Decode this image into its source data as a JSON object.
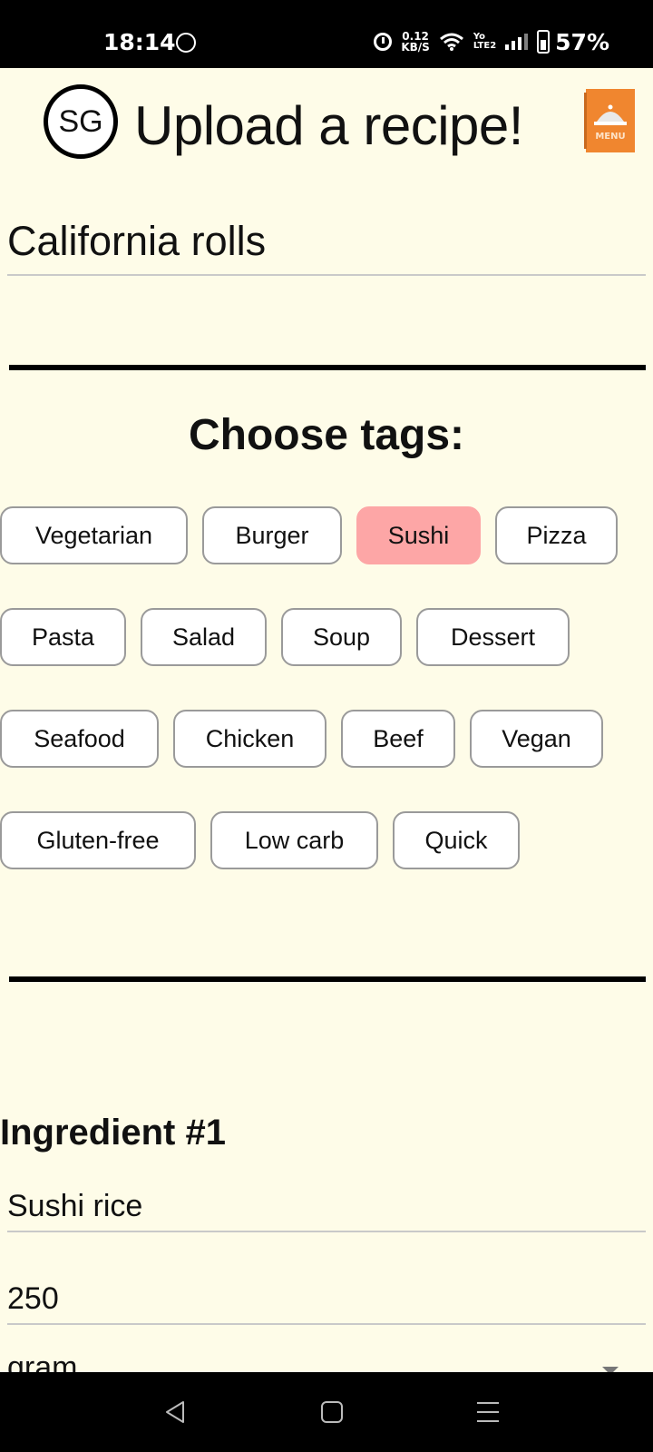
{
  "status_bar": {
    "time": "18:14",
    "net_speed_value": "0.12",
    "net_speed_unit": "KB/S",
    "lte_top": "Yo",
    "lte_bottom": "LTE2",
    "battery": "57%"
  },
  "header": {
    "logo_text": "SG",
    "title": "Upload a recipe!",
    "menu_label": "MENU",
    "menu_color": "#f0862f"
  },
  "recipe": {
    "name": "California rolls"
  },
  "tags": {
    "heading": "Choose tags:",
    "items": [
      {
        "label": "Vegetarian",
        "selected": false
      },
      {
        "label": "Burger",
        "selected": false
      },
      {
        "label": "Sushi",
        "selected": true
      },
      {
        "label": "Pizza",
        "selected": false
      },
      {
        "label": "Pasta",
        "selected": false
      },
      {
        "label": "Salad",
        "selected": false
      },
      {
        "label": "Soup",
        "selected": false
      },
      {
        "label": "Dessert",
        "selected": false
      },
      {
        "label": "Seafood",
        "selected": false
      },
      {
        "label": "Chicken",
        "selected": false
      },
      {
        "label": "Beef",
        "selected": false
      },
      {
        "label": "Vegan",
        "selected": false
      },
      {
        "label": "Gluten-free",
        "selected": false
      },
      {
        "label": "Low carb",
        "selected": false
      },
      {
        "label": "Quick",
        "selected": false
      }
    ],
    "selected_color": "#fda6a6"
  },
  "ingredient": {
    "heading": "Ingredient #1",
    "name": "Sushi rice",
    "amount": "250",
    "unit": "gram"
  },
  "colors": {
    "background": "#fefce8",
    "accent": "#fda6a6"
  }
}
